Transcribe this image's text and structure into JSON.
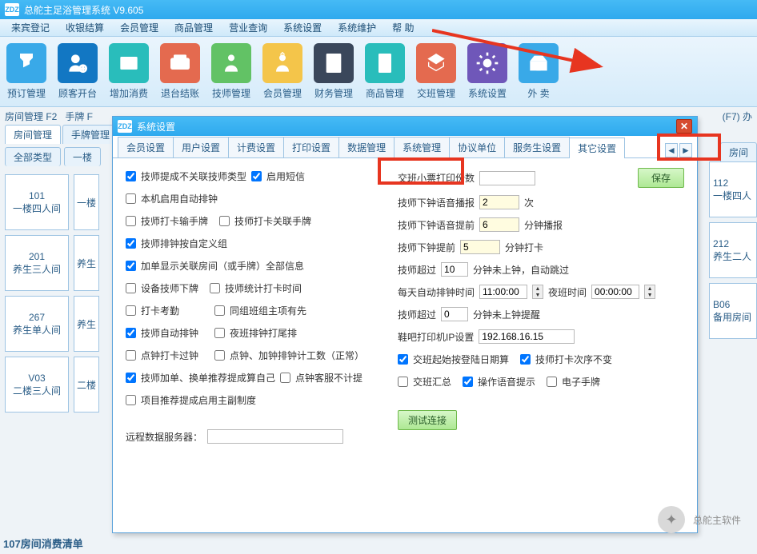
{
  "app": {
    "title": "总舵主足浴管理系统  V9.605"
  },
  "menu": [
    "来宾登记",
    "收银结算",
    "会员管理",
    "商品管理",
    "营业查询",
    "系统设置",
    "系统维护",
    "帮 助"
  ],
  "toolbar": [
    {
      "label": "预订管理",
      "color": "#39a9e8"
    },
    {
      "label": "顾客开台",
      "color": "#1277c3"
    },
    {
      "label": "增加消费",
      "color": "#29bdbb"
    },
    {
      "label": "退台结账",
      "color": "#e46a4f"
    },
    {
      "label": "技师管理",
      "color": "#62c265"
    },
    {
      "label": "会员管理",
      "color": "#f4c54a"
    },
    {
      "label": "财务管理",
      "color": "#3a475b"
    },
    {
      "label": "商品管理",
      "color": "#29bdbb"
    },
    {
      "label": "交班管理",
      "color": "#e46a4f"
    },
    {
      "label": "系统设置",
      "color": "#6f57b9"
    },
    {
      "label": "外 卖",
      "color": "#39a9e8"
    }
  ],
  "subbar": {
    "left": "房间管理 F2",
    "mid": "手牌 F",
    "right": "(F7) 办"
  },
  "tabs2": [
    "房间管理",
    "手牌管理"
  ],
  "filter": {
    "all": "全部类型",
    "floor": "一楼",
    "room_btn": "房间"
  },
  "rooms_left": [
    {
      "num": "101",
      "name": "一楼四人间"
    },
    {
      "num": "201",
      "name": "养生三人间"
    },
    {
      "num": "267",
      "name": "养生单人间"
    },
    {
      "num": "V03",
      "name": "二楼三人间"
    }
  ],
  "rooms_left2": [
    "一楼",
    "养生",
    "养生",
    "二楼"
  ],
  "rooms_right": [
    {
      "num": "112",
      "name": "一楼四人"
    },
    {
      "num": "212",
      "name": "养生二人"
    },
    {
      "num": "B06",
      "name": "备用房间"
    }
  ],
  "dialog": {
    "title": "系统设置",
    "tabs": [
      "会员设置",
      "用户设置",
      "计费设置",
      "打印设置",
      "数据管理",
      "系统管理",
      "协议单位",
      "服务生设置",
      "其它设置"
    ],
    "save": "保存",
    "test": "测试连接",
    "left": {
      "c1": "技师提成不关联技师类型",
      "c1b": "启用短信",
      "c2": "本机启用自动排钟",
      "c3": "技师打卡输手牌",
      "c3b": "技师打卡关联手牌",
      "c4": "技师排钟按自定义组",
      "c5": "加单显示关联房间（或手牌）全部信息",
      "c6": "设备技师下牌",
      "c6b": "技师统计打卡时间",
      "c7": "打卡考勤",
      "c7b": "同组班组主项有先",
      "c8": "技师自动排钟",
      "c8b": "夜班排钟打尾排",
      "c9": "点钟打卡过钟",
      "c9b": "点钟、加钟排钟计工数（正常）",
      "c10": "技师加单、换单推荐提成算自己",
      "c10b": "点钟客服不计提",
      "c11": "项目推荐提成启用主副制度",
      "remote": "远程数据服务器："
    },
    "right": {
      "r1": "交班小票打印份数",
      "r2": "技师下钟语音播报",
      "r2v": "2",
      "r2u": "次",
      "r3": "技师下钟语音提前",
      "r3v": "6",
      "r3u": "分钟播报",
      "r4": "技师下钟提前",
      "r4v": "5",
      "r4u": "分钟打卡",
      "r5": "技师超过",
      "r5v": "10",
      "r5u": "分钟未上钟，自动跳过",
      "r6": "每天自动排钟时间",
      "r6v": "11:00:00",
      "r6b": "夜班时间",
      "r6v2": "00:00:00",
      "r7": "技师超过",
      "r7v": "0",
      "r7u": "分钟未上钟提醒",
      "r8": "鞋吧打印机IP设置",
      "r8v": "192.168.16.15",
      "r9a": "交班起始按登陆日期算",
      "r9b": "技师打卡次序不变",
      "r10a": "交班汇总",
      "r10b": "操作语音提示",
      "r10c": "电子手牌"
    }
  },
  "footer": "107房间消费清单",
  "watermark": "总舵主软件"
}
